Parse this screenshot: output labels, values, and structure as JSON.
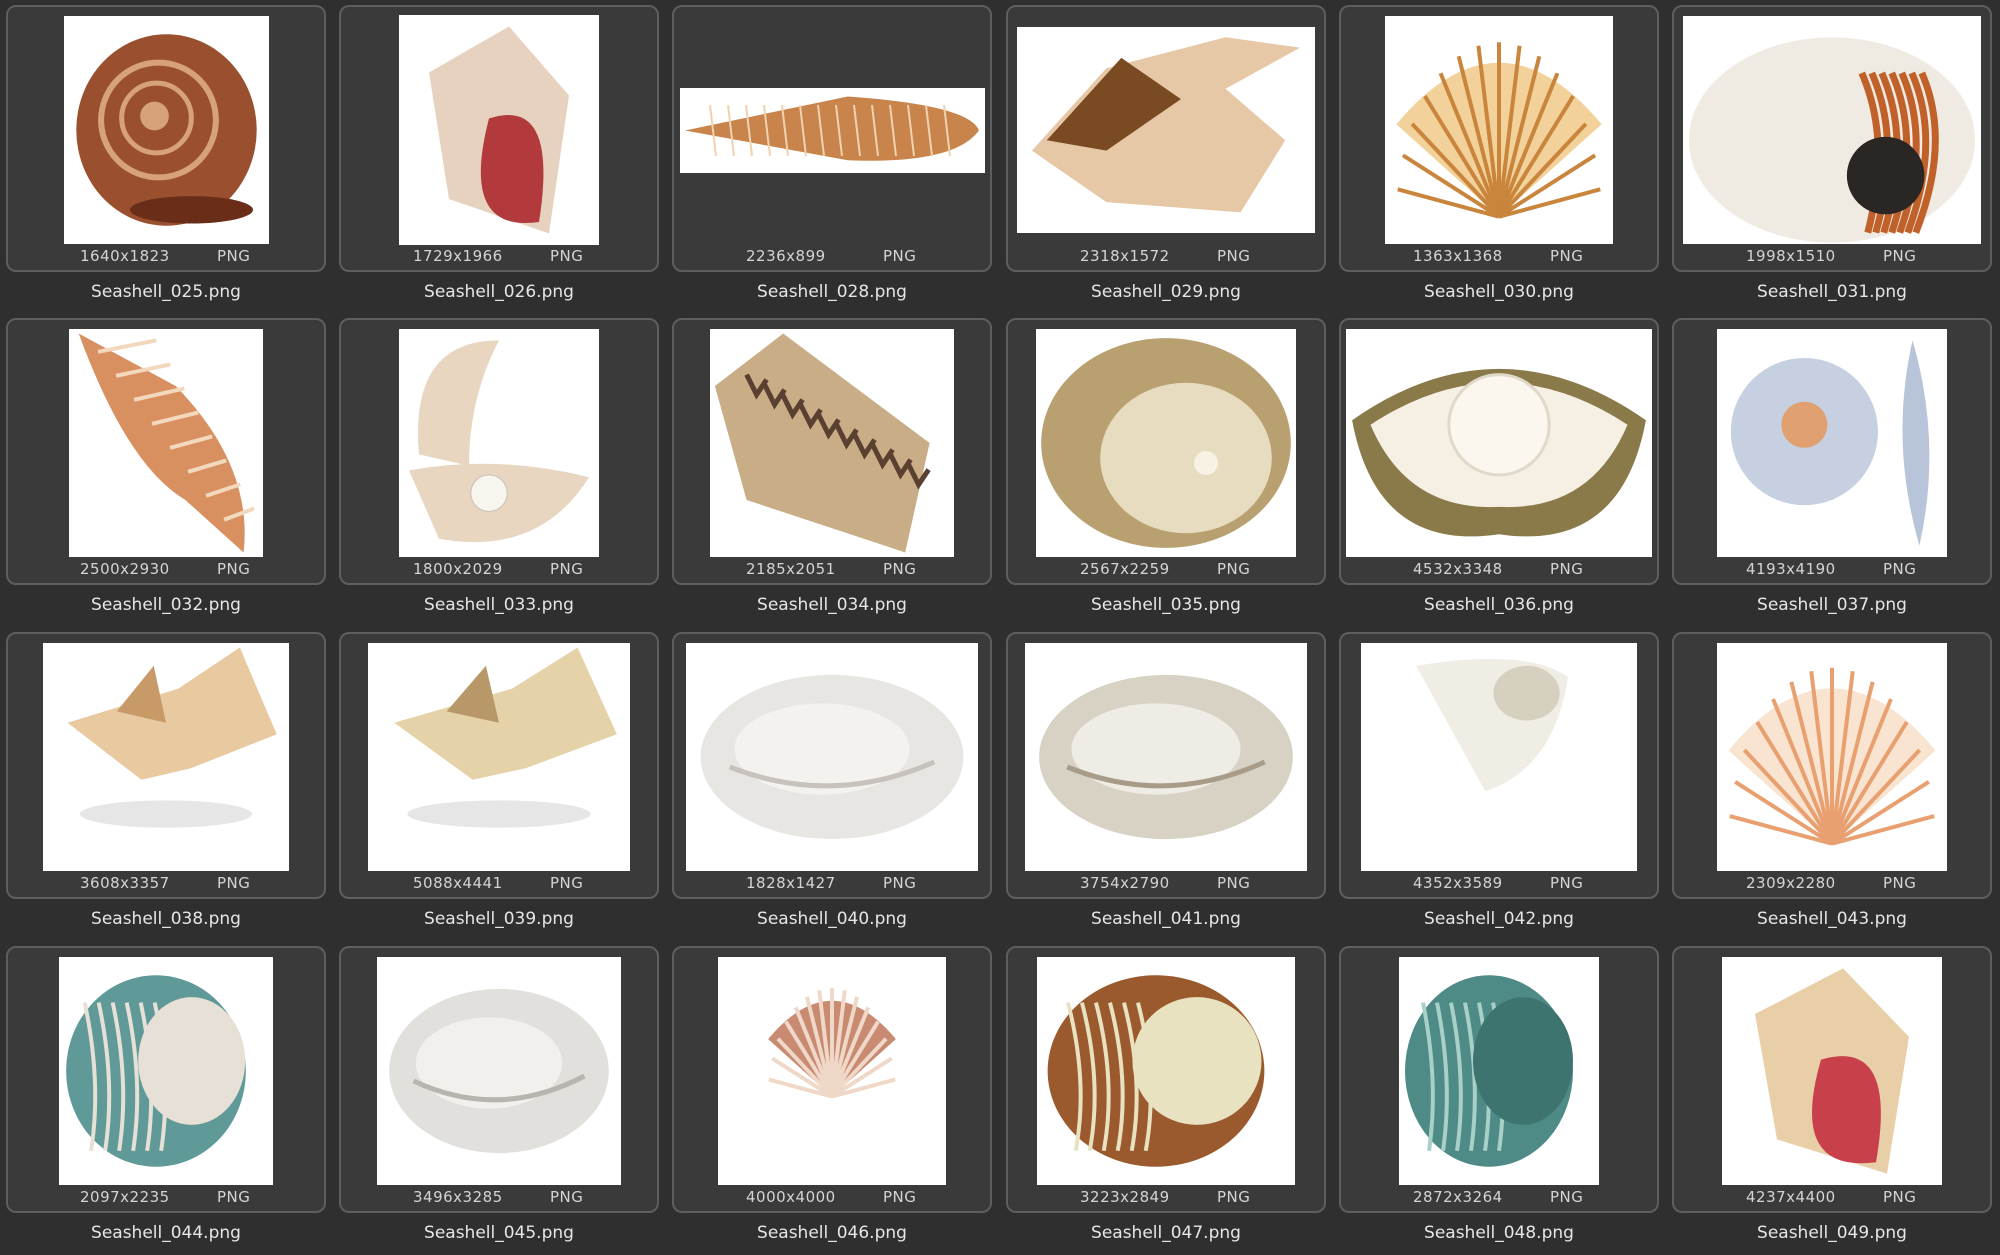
{
  "files": [
    {
      "name": "Seashell_025.png",
      "dims": "1640x1823",
      "format": "PNG",
      "icon": "conch-spiral-shell-icon",
      "colors": [
        "#9a4f2e",
        "#d7a27a"
      ],
      "shape": "spiral"
    },
    {
      "name": "Seashell_026.png",
      "dims": "1729x1966",
      "format": "PNG",
      "icon": "queen-conch-shell-icon",
      "colors": [
        "#e6d2bf",
        "#b23a3c"
      ],
      "shape": "conch"
    },
    {
      "name": "Seashell_028.png",
      "dims": "2236x899",
      "format": "PNG",
      "icon": "long-auger-shell-icon",
      "colors": [
        "#c8844a",
        "#f0d2b0"
      ],
      "shape": "long"
    },
    {
      "name": "Seashell_029.png",
      "dims": "2318x1572",
      "format": "PNG",
      "icon": "spider-conch-shell-icon",
      "colors": [
        "#7a4a22",
        "#e6c7a6"
      ],
      "shape": "spider"
    },
    {
      "name": "Seashell_030.png",
      "dims": "1363x1368",
      "format": "PNG",
      "icon": "scallop-shell-icon",
      "colors": [
        "#c9853c",
        "#f2d29a"
      ],
      "shape": "scallop"
    },
    {
      "name": "Seashell_031.png",
      "dims": "1998x1510",
      "format": "PNG",
      "icon": "nautilus-shell-icon",
      "colors": [
        "#efeae2",
        "#c0612a"
      ],
      "shape": "nautilus"
    },
    {
      "name": "Seashell_032.png",
      "dims": "2500x2930",
      "format": "PNG",
      "icon": "whelk-shell-icon",
      "colors": [
        "#d89060",
        "#f3d8bd"
      ],
      "shape": "whelk"
    },
    {
      "name": "Seashell_033.png",
      "dims": "1800x2029",
      "format": "PNG",
      "icon": "open-clam-pearl-icon",
      "colors": [
        "#e8d6c0",
        "#f8f4ee"
      ],
      "shape": "openclam"
    },
    {
      "name": "Seashell_034.png",
      "dims": "2185x2051",
      "format": "PNG",
      "icon": "cone-shell-icon",
      "colors": [
        "#c9ad86",
        "#5a4030"
      ],
      "shape": "cone"
    },
    {
      "name": "Seashell_035.png",
      "dims": "2567x2259",
      "format": "PNG",
      "icon": "oyster-pearl-icon",
      "colors": [
        "#b8a070",
        "#e8dcc0"
      ],
      "shape": "oyster"
    },
    {
      "name": "Seashell_036.png",
      "dims": "4532x3348",
      "format": "PNG",
      "icon": "oyster-big-pearl-icon",
      "colors": [
        "#8a7a4a",
        "#f6efe4"
      ],
      "shape": "bigpearl"
    },
    {
      "name": "Seashell_037.png",
      "dims": "4193x4190",
      "format": "PNG",
      "icon": "watercolor-shells-icon",
      "colors": [
        "#b8c4da",
        "#e0a070"
      ],
      "shape": "watercolor"
    },
    {
      "name": "Seashell_038.png",
      "dims": "3608x3357",
      "format": "PNG",
      "icon": "conch-shell-icon",
      "colors": [
        "#e8c9a0",
        "#c79a68"
      ],
      "shape": "conchside"
    },
    {
      "name": "Seashell_039.png",
      "dims": "5088x4441",
      "format": "PNG",
      "icon": "horned-conch-shell-icon",
      "colors": [
        "#e6d2a8",
        "#b89868"
      ],
      "shape": "horned"
    },
    {
      "name": "Seashell_040.png",
      "dims": "1828x1427",
      "format": "PNG",
      "icon": "pearl-clam-shell-icon",
      "colors": [
        "#e8e6e2",
        "#c8c2bc"
      ],
      "shape": "pearlclam"
    },
    {
      "name": "Seashell_041.png",
      "dims": "3754x2790",
      "format": "PNG",
      "icon": "mother-of-pearl-shell-icon",
      "colors": [
        "#d8d2c4",
        "#a89c88"
      ],
      "shape": "pearlclam"
    },
    {
      "name": "Seashell_042.png",
      "dims": "4352x3589",
      "format": "PNG",
      "icon": "turban-white-shell-icon",
      "colors": [
        "#f0ede4",
        "#d6d0c0"
      ],
      "shape": "turbanwhite"
    },
    {
      "name": "Seashell_043.png",
      "dims": "2309x2280",
      "format": "PNG",
      "icon": "small-scallop-icon",
      "colors": [
        "#e8a070",
        "#f8e4d0"
      ],
      "shape": "scallop"
    },
    {
      "name": "Seashell_044.png",
      "dims": "2097x2235",
      "format": "PNG",
      "icon": "green-turban-shell-icon",
      "colors": [
        "#5f9a98",
        "#e6e0d6"
      ],
      "shape": "turbangreen"
    },
    {
      "name": "Seashell_045.png",
      "dims": "3496x3285",
      "format": "PNG",
      "icon": "pearl-oyster-shell-icon",
      "colors": [
        "#e2e0dc",
        "#b8b4ae"
      ],
      "shape": "pearlclam"
    },
    {
      "name": "Seashell_046.png",
      "dims": "4000x4000",
      "format": "PNG",
      "icon": "tiny-scallop-icon",
      "colors": [
        "#f0d8c8",
        "#c88a70"
      ],
      "shape": "tinyscallop"
    },
    {
      "name": "Seashell_047.png",
      "dims": "3223x2849",
      "format": "PNG",
      "icon": "brown-turban-shell-icon",
      "colors": [
        "#9a5a2e",
        "#e8e2c0"
      ],
      "shape": "turbanbrown"
    },
    {
      "name": "Seashell_048.png",
      "dims": "2872x3264",
      "format": "PNG",
      "icon": "teal-turban-shell-icon",
      "colors": [
        "#4e8a86",
        "#a8d0c8"
      ],
      "shape": "turbanteal"
    },
    {
      "name": "Seashell_049.png",
      "dims": "4237x4400",
      "format": "PNG",
      "icon": "pink-conch-shell-icon",
      "colors": [
        "#e8cfa8",
        "#c8404a"
      ],
      "shape": "conchpink"
    }
  ]
}
